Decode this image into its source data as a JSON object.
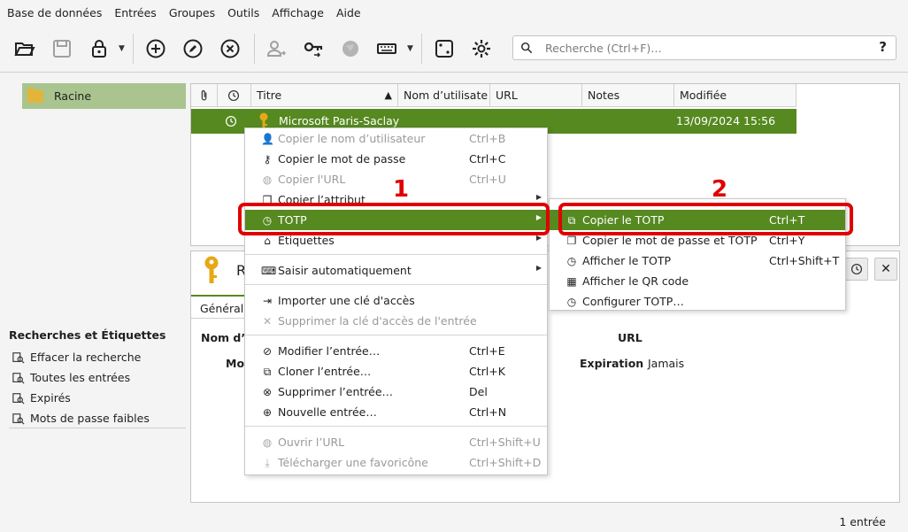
{
  "menubar": {
    "items": [
      "Base de données",
      "Entrées",
      "Groupes",
      "Outils",
      "Affichage",
      "Aide"
    ]
  },
  "toolbar": {
    "icons": [
      "open-db-icon",
      "save-db-icon",
      "lock-icon",
      "add-entry-icon",
      "edit-entry-icon",
      "delete-entry-icon",
      "copy-username-icon",
      "copy-password-icon",
      "open-url-icon",
      "autotype-icon",
      "password-generator-icon",
      "settings-icon"
    ]
  },
  "search": {
    "placeholder": "Recherche (Ctrl+F)…",
    "help": "?"
  },
  "groups": {
    "root": "Racine"
  },
  "searches": {
    "title": "Recherches et Étiquettes",
    "items": [
      "Effacer la recherche",
      "Toutes les entrées",
      "Expirés",
      "Mots de passe faibles"
    ]
  },
  "table": {
    "columns": [
      "Titre",
      "Nom d’utilisate",
      "URL",
      "Notes",
      "Modifiée"
    ],
    "row": {
      "title": "Microsoft Paris-Saclay",
      "modified": "13/09/2024 15:56"
    }
  },
  "details": {
    "title_initial": "R",
    "tab": "Général",
    "label_username": "Nom d’",
    "label_password": "Mot",
    "label_url": "URL",
    "label_expiration": "Expiration",
    "expiration_value": "Jamais"
  },
  "context_menu": {
    "items": [
      {
        "label": "Copier le nom d’utilisateur",
        "shortcut": "Ctrl+B"
      },
      {
        "label": "Copier le mot de passe",
        "shortcut": "Ctrl+C"
      },
      {
        "label": "Copier l'URL",
        "shortcut": "Ctrl+U"
      },
      {
        "label": "Copier l’attribut",
        "shortcut": ""
      },
      {
        "label": "TOTP",
        "shortcut": ""
      },
      {
        "label": "Étiquettes",
        "shortcut": ""
      },
      {
        "label": "Saisir automatiquement",
        "shortcut": ""
      },
      {
        "label": "Importer une clé d'accès",
        "shortcut": ""
      },
      {
        "label": "Supprimer la clé d'accès de l'entrée",
        "shortcut": ""
      },
      {
        "label": "Modifier l’entrée…",
        "shortcut": "Ctrl+E"
      },
      {
        "label": "Cloner l’entrée…",
        "shortcut": "Ctrl+K"
      },
      {
        "label": "Supprimer l’entrée…",
        "shortcut": "Del"
      },
      {
        "label": "Nouvelle entrée…",
        "shortcut": "Ctrl+N"
      },
      {
        "label": "Ouvrir l’URL",
        "shortcut": "Ctrl+Shift+U"
      },
      {
        "label": "Télécharger une favoricône",
        "shortcut": "Ctrl+Shift+D"
      }
    ]
  },
  "totp_menu": {
    "items": [
      {
        "label": "Copier le TOTP",
        "shortcut": "Ctrl+T"
      },
      {
        "label": "Copier le mot de passe et TOTP",
        "shortcut": "Ctrl+Y"
      },
      {
        "label": "Afficher le TOTP",
        "shortcut": "Ctrl+Shift+T"
      },
      {
        "label": "Afficher le QR code",
        "shortcut": ""
      },
      {
        "label": "Configurer TOTP…",
        "shortcut": ""
      }
    ]
  },
  "annotations": {
    "step1": "1",
    "step2": "2",
    "color": "#e00000"
  },
  "status": {
    "count": "1 entrée"
  },
  "colors": {
    "selection": "#568920",
    "root_highlight": "#a9c48f"
  }
}
